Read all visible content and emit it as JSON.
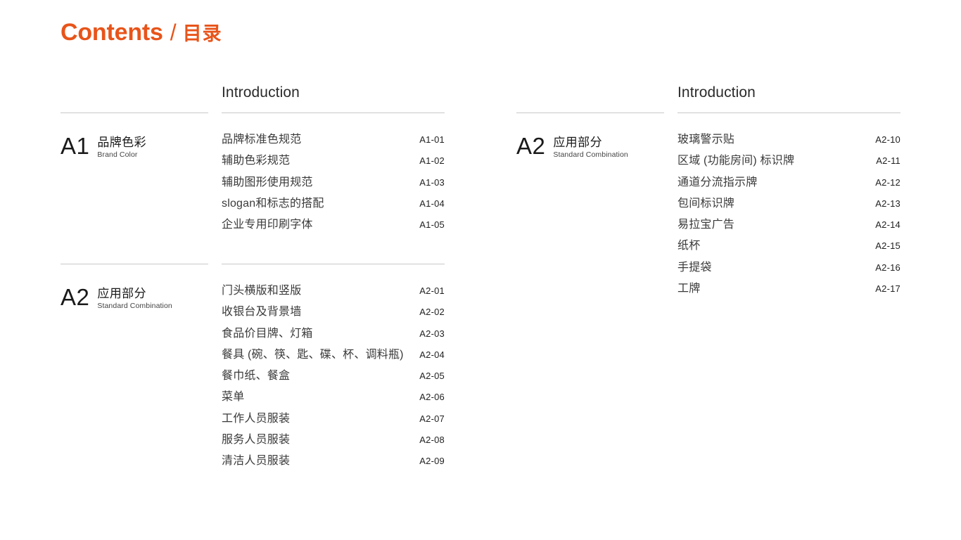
{
  "title": {
    "en": "Contents",
    "separator": "/",
    "cn": "目录"
  },
  "theme": {
    "accent": "#E8541A",
    "text": "#3a3a3a",
    "rule": "#c9c9c9",
    "background": "#ffffff"
  },
  "columns": [
    {
      "id": "left",
      "intro_label": "Introduction",
      "sections": [
        {
          "code": "A1",
          "name_cn": "品牌色彩",
          "name_en": "Brand Color",
          "entries": [
            {
              "title": "品牌标准色规范",
              "code": "A1-01"
            },
            {
              "title": "辅助色彩规范",
              "code": "A1-02"
            },
            {
              "title": "辅助图形使用规范",
              "code": "A1-03"
            },
            {
              "title": "slogan和标志的搭配",
              "code": "A1-04"
            },
            {
              "title": "企业专用印刷字体",
              "code": "A1-05"
            }
          ]
        },
        {
          "code": "A2",
          "name_cn": "应用部分",
          "name_en": "Standard Combination",
          "entries": [
            {
              "title": "门头横版和竖版",
              "code": "A2-01"
            },
            {
              "title": "收银台及背景墙",
              "code": "A2-02"
            },
            {
              "title": "食品价目牌、灯箱",
              "code": "A2-03"
            },
            {
              "title": "餐具 (碗、筷、匙、碟、杯、调料瓶)",
              "code": "A2-04"
            },
            {
              "title": "餐巾纸、餐盒",
              "code": "A2-05"
            },
            {
              "title": "菜单",
              "code": "A2-06"
            },
            {
              "title": "工作人员服装",
              "code": "A2-07"
            },
            {
              "title": "服务人员服装",
              "code": "A2-08"
            },
            {
              "title": "清洁人员服装",
              "code": "A2-09"
            }
          ]
        }
      ]
    },
    {
      "id": "right",
      "intro_label": "Introduction",
      "sections": [
        {
          "code": "A2",
          "name_cn": "应用部分",
          "name_en": "Standard Combination",
          "entries": [
            {
              "title": "玻璃警示贴",
              "code": "A2-10"
            },
            {
              "title": "区域 (功能房间) 标识牌",
              "code": "A2-11"
            },
            {
              "title": "通道分流指示牌",
              "code": "A2-12"
            },
            {
              "title": "包间标识牌",
              "code": "A2-13"
            },
            {
              "title": "易拉宝广告",
              "code": "A2-14"
            },
            {
              "title": "纸杯",
              "code": "A2-15"
            },
            {
              "title": "手提袋",
              "code": "A2-16"
            },
            {
              "title": "工牌",
              "code": "A2-17"
            }
          ]
        }
      ]
    }
  ]
}
